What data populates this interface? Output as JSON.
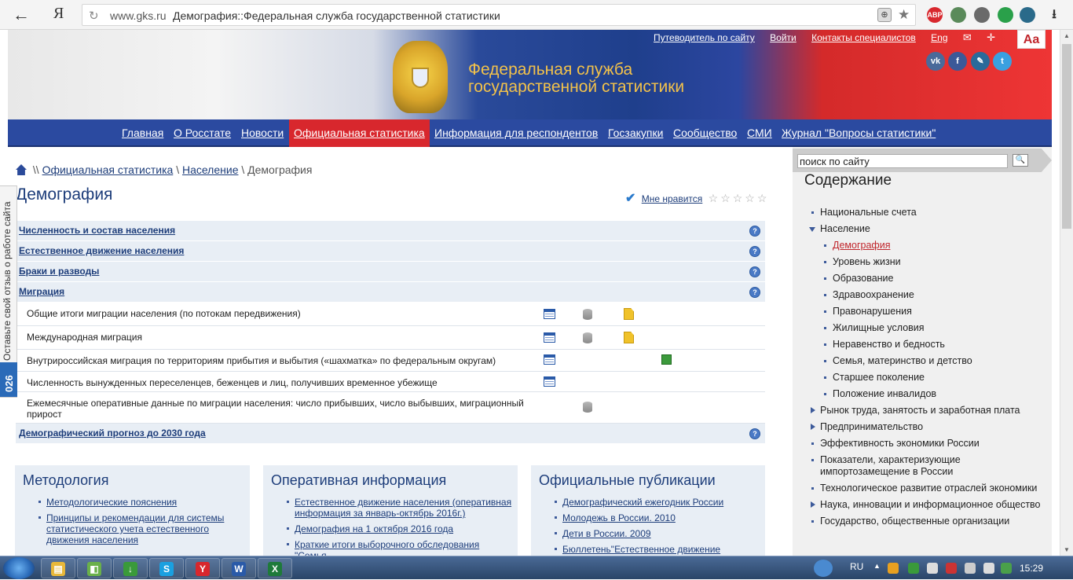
{
  "browser": {
    "logo": "Я",
    "domain": "www.gks.ru",
    "title": "Демография::Федеральная служба государственной статистики",
    "ext_badge": "ABP"
  },
  "header": {
    "org_line1": "Федеральная служба",
    "org_line2": "государственной статистики",
    "top_links": [
      "Путеводитель по сайту",
      "Войти",
      "Контакты специалистов",
      "Eng"
    ],
    "font_toggle": "Aa",
    "social": [
      "vk",
      "f",
      "✎",
      "t"
    ]
  },
  "nav": {
    "items": [
      {
        "label": "Главная"
      },
      {
        "label": "О Росстате"
      },
      {
        "label": "Новости"
      },
      {
        "label": "Официальная статистика",
        "active": true
      },
      {
        "label": "Информация для респондентов"
      },
      {
        "label": "Госзакупки"
      },
      {
        "label": "Сообщество"
      },
      {
        "label": "СМИ"
      },
      {
        "label": "Журнал \"Вопросы статистики\""
      }
    ]
  },
  "breadcrumb": {
    "sep1": "\\\\",
    "items": [
      "Официальная статистика",
      "Население"
    ],
    "sep": "\\",
    "current": "Демография"
  },
  "page": {
    "title": "Демография",
    "like": "Мне нравится",
    "stars": "☆☆☆☆☆"
  },
  "sections": {
    "top": [
      "Численность и состав населения",
      "Естественное движение населения",
      "Браки и разводы",
      "Миграция"
    ],
    "migration_rows": [
      {
        "text": "Общие итоги миграции населения (по потокам передвижения)",
        "icons": [
          "table-icon",
          "database-icon",
          "document-icon"
        ]
      },
      {
        "text": "Международная миграция",
        "icons": [
          "table-icon",
          "database-icon",
          "document-icon"
        ]
      },
      {
        "text": "Внутрироссийская миграция по территориям прибытия и выбытия («шахматка» по федеральным округам)",
        "icons": [
          "table-icon",
          "spreadsheet-icon"
        ]
      },
      {
        "text": "Численность вынужденных переселенцев, беженцев и лиц, получивших временное убежище",
        "icons": [
          "table-icon"
        ]
      },
      {
        "text": "Ежемесячные оперативные данные по миграции населения: число прибывших, число выбывших, миграционный прирост",
        "icons": [
          "database-icon"
        ]
      }
    ],
    "last": "Демографический прогноз до 2030 года"
  },
  "boxes": {
    "methodology": {
      "title": "Методология",
      "items": [
        "Методологические пояснения",
        "Принципы и рекомендации для системы статистического учета естественного движения населения"
      ]
    },
    "operative": {
      "title": "Оперативная информация",
      "items": [
        "Естественное движение населения (оперативная информация за январь-октябрь 2016г.)",
        "Демография на 1 октября 2016 года",
        "Краткие итоги выборочного обследования \"Семья"
      ]
    },
    "publications": {
      "title": "Официальные публикации",
      "items": [
        "Демографический ежегодник России",
        "Молодежь в России. 2010",
        "Дети в России. 2009",
        "Бюллетень\"Естественное движение"
      ]
    }
  },
  "sidebar": {
    "search_value": "поиск по сайту",
    "title": "Содержание",
    "toc": [
      {
        "label": "Национальные счета",
        "marker": "bullet",
        "level": 0
      },
      {
        "label": "Население",
        "marker": "open",
        "level": 0
      },
      {
        "label": "Демография",
        "marker": "bullet",
        "level": 1,
        "active": true
      },
      {
        "label": "Уровень жизни",
        "marker": "bullet",
        "level": 1
      },
      {
        "label": "Образование",
        "marker": "bullet",
        "level": 1
      },
      {
        "label": "Здравоохранение",
        "marker": "bullet",
        "level": 1
      },
      {
        "label": "Правонарушения",
        "marker": "bullet",
        "level": 1
      },
      {
        "label": "Жилищные условия",
        "marker": "bullet",
        "level": 1
      },
      {
        "label": "Неравенство и бедность",
        "marker": "bullet",
        "level": 1
      },
      {
        "label": "Семья, материнство и детство",
        "marker": "bullet",
        "level": 1
      },
      {
        "label": "Старшее поколение",
        "marker": "bullet",
        "level": 1
      },
      {
        "label": "Положение инвалидов",
        "marker": "bullet",
        "level": 1
      },
      {
        "label": "Рынок труда, занятость и заработная плата",
        "marker": "closed",
        "level": 0
      },
      {
        "label": "Предпринимательство",
        "marker": "closed",
        "level": 0
      },
      {
        "label": "Эффективность экономики России",
        "marker": "bullet",
        "level": 0
      },
      {
        "label": "Показатели, характеризующие импортозамещение в России",
        "marker": "bullet",
        "level": 0
      },
      {
        "label": "Технологическое развитие отраслей экономики",
        "marker": "bullet",
        "level": 0
      },
      {
        "label": "Наука, инновации и информационное общество",
        "marker": "closed",
        "level": 0
      },
      {
        "label": "Государство, общественные организации",
        "marker": "bullet",
        "level": 0
      }
    ]
  },
  "feedback": {
    "label": "Оставьте свой отзыв о работе сайта",
    "count": "026"
  },
  "taskbar": {
    "apps": [
      {
        "glyph": "▤",
        "color": "#e8b83a"
      },
      {
        "glyph": "◧",
        "color": "#6ab04a"
      },
      {
        "glyph": "↓",
        "color": "#3a9a3a"
      },
      {
        "glyph": "S",
        "color": "#1aa0e0"
      },
      {
        "glyph": "Y",
        "color": "#d8272d"
      },
      {
        "glyph": "W",
        "color": "#2a5aa8"
      },
      {
        "glyph": "X",
        "color": "#1e7a3a"
      }
    ],
    "lang": "RU",
    "time": "15:29"
  }
}
